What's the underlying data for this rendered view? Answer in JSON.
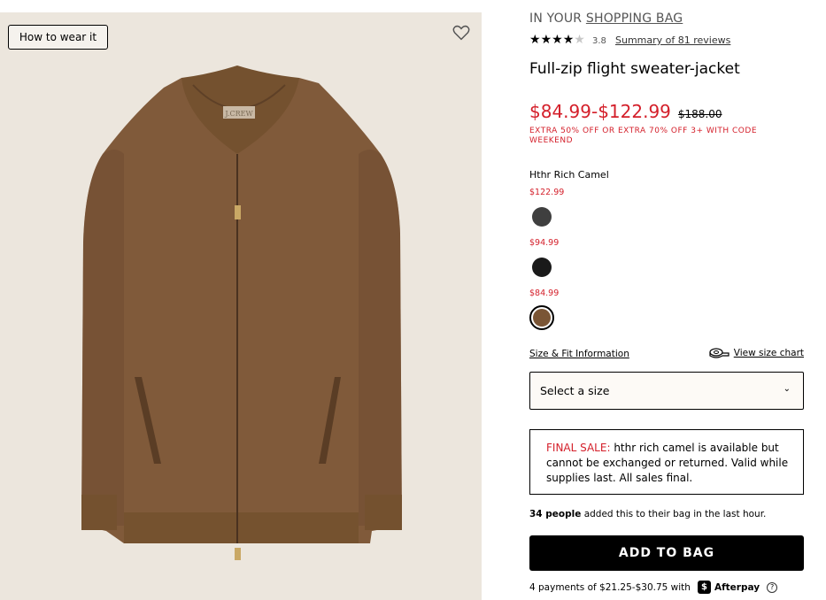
{
  "image_panel": {
    "how_to_wear_label": "How to wear it",
    "brand_tag": "J.CREW",
    "wishlist_icon": "heart-icon"
  },
  "product": {
    "bag_prefix": "IN YOUR ",
    "bag_link": "SHOPPING BAG",
    "rating_stars": 3.8,
    "rating_value": "3.8",
    "reviews_link": "Summary of 81 reviews",
    "title": "Full-zip flight sweater-jacket",
    "price_range": "$84.99-$122.99",
    "original_price": "$188.00",
    "promo": "EXTRA 50% OFF OR EXTRA 70% OFF 3+ WITH CODE WEEKEND",
    "selected_color": "Hthr Rich Camel",
    "swatches": [
      {
        "price": "$122.99",
        "color": "#3f3f3f"
      },
      {
        "price": "$94.99",
        "color": "#1a1a1a"
      },
      {
        "price": "$84.99",
        "color": "#7a5535",
        "selected": true
      }
    ],
    "size_fit_link": "Size & Fit Information",
    "size_chart_link": "View size chart",
    "size_select_label": "Select a size",
    "final_sale_prefix": "FINAL SALE:",
    "final_sale_text": " hthr rich camel is available but cannot be exchanged or returned. Valid while supplies last. All sales final.",
    "social_count": "34 people",
    "social_text": " added this to their bag in the last hour.",
    "add_to_bag": "ADD TO BAG",
    "afterpay_text": "4 payments of $21.25-$30.75 with",
    "afterpay_logo": "$",
    "afterpay_name": "Afterpay",
    "info_icon": "?"
  },
  "colors": {
    "sale_red": "#d41f2a",
    "sweater": "#805a3a",
    "background": "#ece6dd"
  }
}
